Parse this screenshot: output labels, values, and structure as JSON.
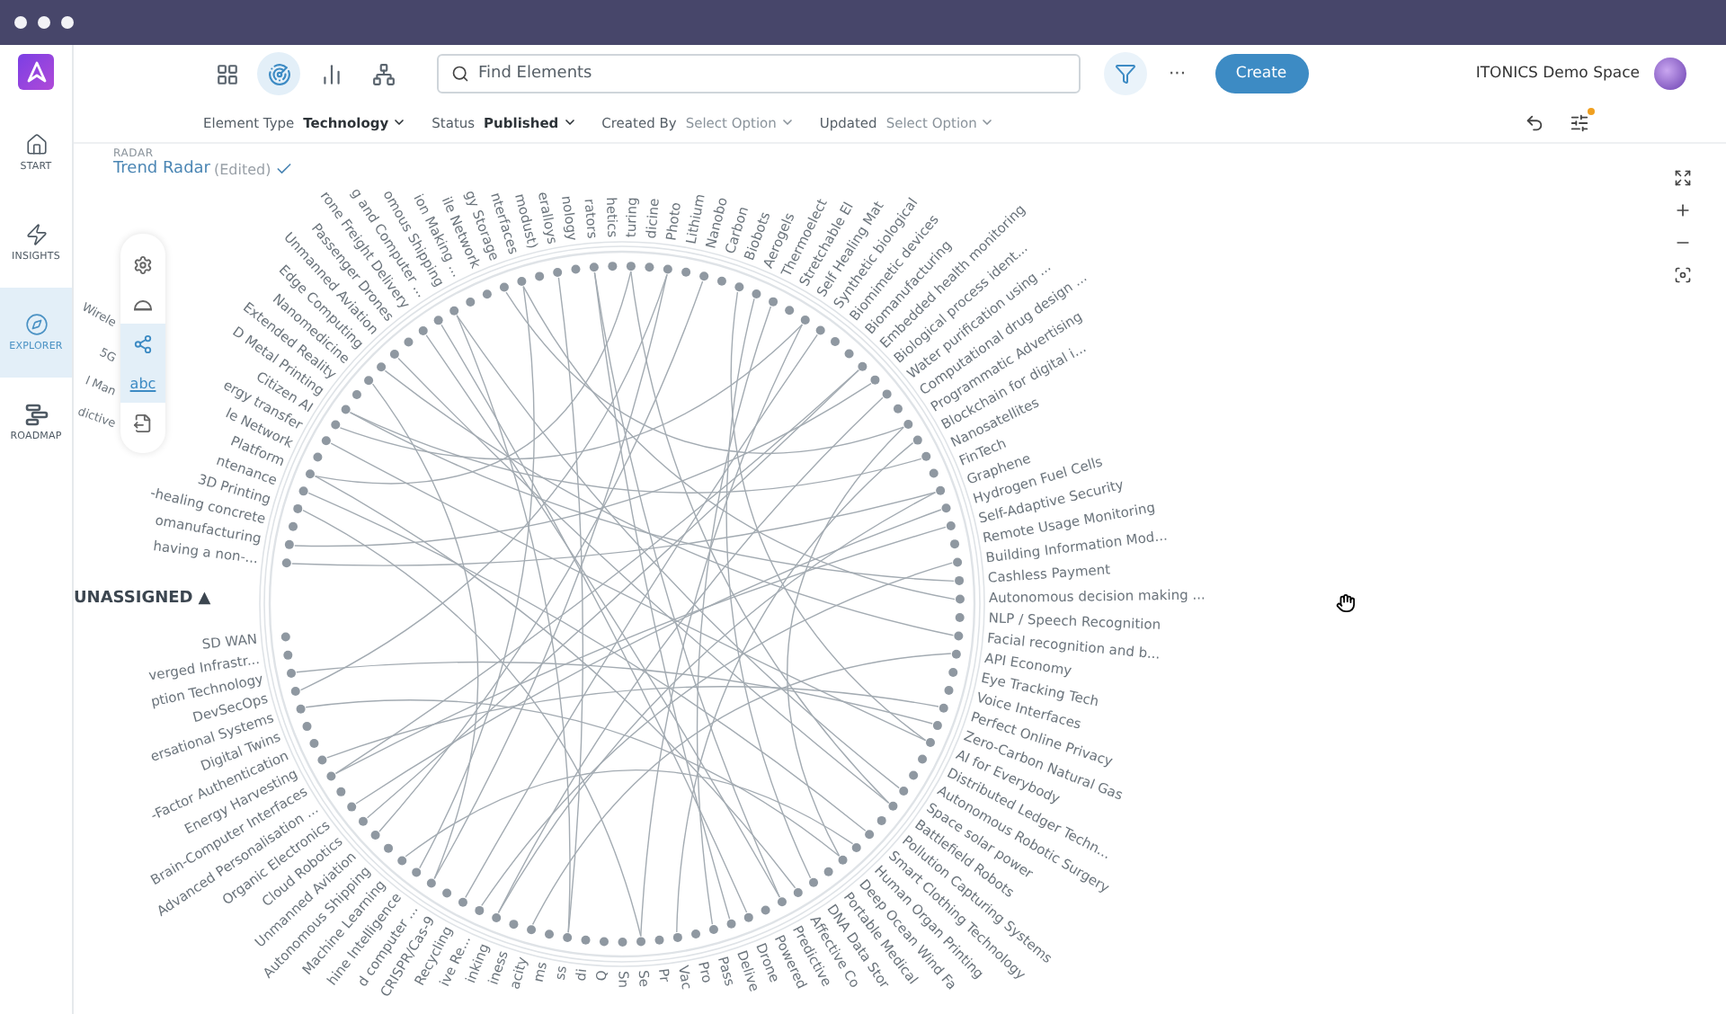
{
  "header": {
    "views": [
      {
        "kind": "grid",
        "selected": false
      },
      {
        "kind": "radar",
        "selected": true
      },
      {
        "kind": "chart",
        "selected": false
      },
      {
        "kind": "network",
        "selected": false
      }
    ],
    "search": {
      "placeholder": "Find Elements"
    },
    "more": "···",
    "create_button": "Create",
    "workspace": "ITONICS Demo Space"
  },
  "filters": {
    "items": [
      {
        "label": "Element Type",
        "value": "Technology",
        "kind": "value"
      },
      {
        "label": "Status",
        "value": "Published",
        "kind": "value"
      },
      {
        "label": "Created By",
        "value": "Select Option",
        "kind": "placeholder"
      },
      {
        "label": "Updated",
        "value": "Select Option",
        "kind": "placeholder"
      }
    ],
    "settings_notification": true
  },
  "sidebar": {
    "items": [
      {
        "label": "START",
        "kind": "home",
        "selected": false
      },
      {
        "label": "INSIGHTS",
        "kind": "insights",
        "selected": false
      },
      {
        "label": "EXPLORER",
        "kind": "explorer",
        "selected": true
      },
      {
        "label": "ROADMAP",
        "kind": "roadmap",
        "selected": false
      }
    ]
  },
  "radar": {
    "section": "RADAR",
    "title": "Trend Radar",
    "status": "(Edited)",
    "tools": [
      {
        "kind": "settings",
        "selected": false
      },
      {
        "kind": "dome",
        "selected": false
      },
      {
        "kind": "network",
        "selected": true
      },
      {
        "kind": "text",
        "label": "abc",
        "selected": true
      },
      {
        "kind": "export",
        "selected": false
      }
    ],
    "group": {
      "title": "UNASSIGNED",
      "toggle": "▲"
    },
    "labels": [
      {
        "text": "having a non-..."
      },
      {
        "text": "omanufacturing"
      },
      {
        "text": "-healing concrete"
      },
      {
        "text": "3D Printing"
      },
      {
        "text": "ntenance",
        "lead": "dictive"
      },
      {
        "text": "Platform",
        "lead": "l Man"
      },
      {
        "text": "le Network",
        "lead": "5G"
      },
      {
        "text": "ergy transfer",
        "lead": "Wirele"
      },
      {
        "text": "Citizen AI"
      },
      {
        "text": "D Metal Printing"
      },
      {
        "text": "Extended Reality"
      },
      {
        "text": "Nanomedicine"
      },
      {
        "text": "Edge Computing"
      },
      {
        "text": "Unmanned Aviation"
      },
      {
        "text": "Passenger Drones"
      },
      {
        "text": "rone Freight Delivery"
      },
      {
        "text": "g and Computer ..."
      },
      {
        "text": "omous Shipping"
      },
      {
        "text": "ion Making ..."
      },
      {
        "text": "ile Network"
      },
      {
        "text": "gy Storage"
      },
      {
        "text": "nterfaces"
      },
      {
        "text": "modust)"
      },
      {
        "text": "eralloys"
      },
      {
        "text": "nology"
      },
      {
        "text": "rators"
      },
      {
        "text": "hetics"
      },
      {
        "text": "turing"
      },
      {
        "text": "dicine"
      },
      {
        "text": "Photo"
      },
      {
        "text": "Lithium"
      },
      {
        "text": "Nanobo"
      },
      {
        "text": "Carbon"
      },
      {
        "text": "Biobots"
      },
      {
        "text": "Aerogels"
      },
      {
        "text": "Thermoelect"
      },
      {
        "text": "Stretchable El"
      },
      {
        "text": "Self Healing Mat"
      },
      {
        "text": "Synthetic biological"
      },
      {
        "text": "Biomimetic devices"
      },
      {
        "text": "Biomanufacturing"
      },
      {
        "text": "Embedded health monitoring"
      },
      {
        "text": "Biological process ident..."
      },
      {
        "text": "Water purification using ..."
      },
      {
        "text": "Computational drug design ..."
      },
      {
        "text": "Programmatic Advertising"
      },
      {
        "text": "Blockchain for digital i..."
      },
      {
        "text": "Nanosatellites"
      },
      {
        "text": "FinTech"
      },
      {
        "text": "Graphene"
      },
      {
        "text": "Hydrogen Fuel Cells"
      },
      {
        "text": "Self-Adaptive Security"
      },
      {
        "text": "Remote Usage Monitoring"
      },
      {
        "text": "Building Information Mod..."
      },
      {
        "text": "Cashless Payment"
      },
      {
        "text": "Autonomous decision making ..."
      },
      {
        "text": "NLP / Speech Recognition"
      },
      {
        "text": "Facial recognition and b..."
      },
      {
        "text": "API Economy"
      },
      {
        "text": "Eye Tracking Tech"
      },
      {
        "text": "Voice Interfaces"
      },
      {
        "text": "Perfect Online Privacy"
      },
      {
        "text": "Zero-Carbon Natural Gas"
      },
      {
        "text": "AI for Everybody"
      },
      {
        "text": "Distributed Ledger Techn..."
      },
      {
        "text": "Autonomous Robotic Surgery"
      },
      {
        "text": "Space solar power"
      },
      {
        "text": "Battlefield Robots"
      },
      {
        "text": "Pollution Capturing Systems"
      },
      {
        "text": "Smart Clothing Technology"
      },
      {
        "text": "Human Organ Printing"
      },
      {
        "text": "Deep Ocean Wind Fa"
      },
      {
        "text": "Portable Medical"
      },
      {
        "text": "DNA Data Stor"
      },
      {
        "text": "Affective Co"
      },
      {
        "text": "Predictive"
      },
      {
        "text": "Powered"
      },
      {
        "text": "Drone"
      },
      {
        "text": "Delive"
      },
      {
        "text": "Pass"
      },
      {
        "text": "Pro"
      },
      {
        "text": "Vac"
      },
      {
        "text": "Pr"
      },
      {
        "text": "Se"
      },
      {
        "text": "Sn"
      },
      {
        "text": "Q"
      },
      {
        "text": "di"
      },
      {
        "text": "ss"
      },
      {
        "text": "ms"
      },
      {
        "text": "acity"
      },
      {
        "text": "iness"
      },
      {
        "text": "inking"
      },
      {
        "text": "ive Re..."
      },
      {
        "text": "Recycling"
      },
      {
        "text": "CRISPR/Cas-9"
      },
      {
        "text": "d computer ..."
      },
      {
        "text": "hine Intelligence"
      },
      {
        "text": "Machine Learning"
      },
      {
        "text": "Autonomous Shipping"
      },
      {
        "text": "Unmanned Aviation"
      },
      {
        "text": "Cloud Robotics"
      },
      {
        "text": "Organic Electronics"
      },
      {
        "text": "Advanced Personalisation ..."
      },
      {
        "text": "Brain-Computer Interfaces"
      },
      {
        "text": "Energy Harvesting"
      },
      {
        "text": "-Factor Authentication"
      },
      {
        "text": "Digital Twins"
      },
      {
        "text": "ersational Systems"
      },
      {
        "text": "DevSecOps"
      },
      {
        "text": "ption Technology"
      },
      {
        "text": "verged Infrastr..."
      },
      {
        "text": "SD WAN"
      }
    ]
  }
}
